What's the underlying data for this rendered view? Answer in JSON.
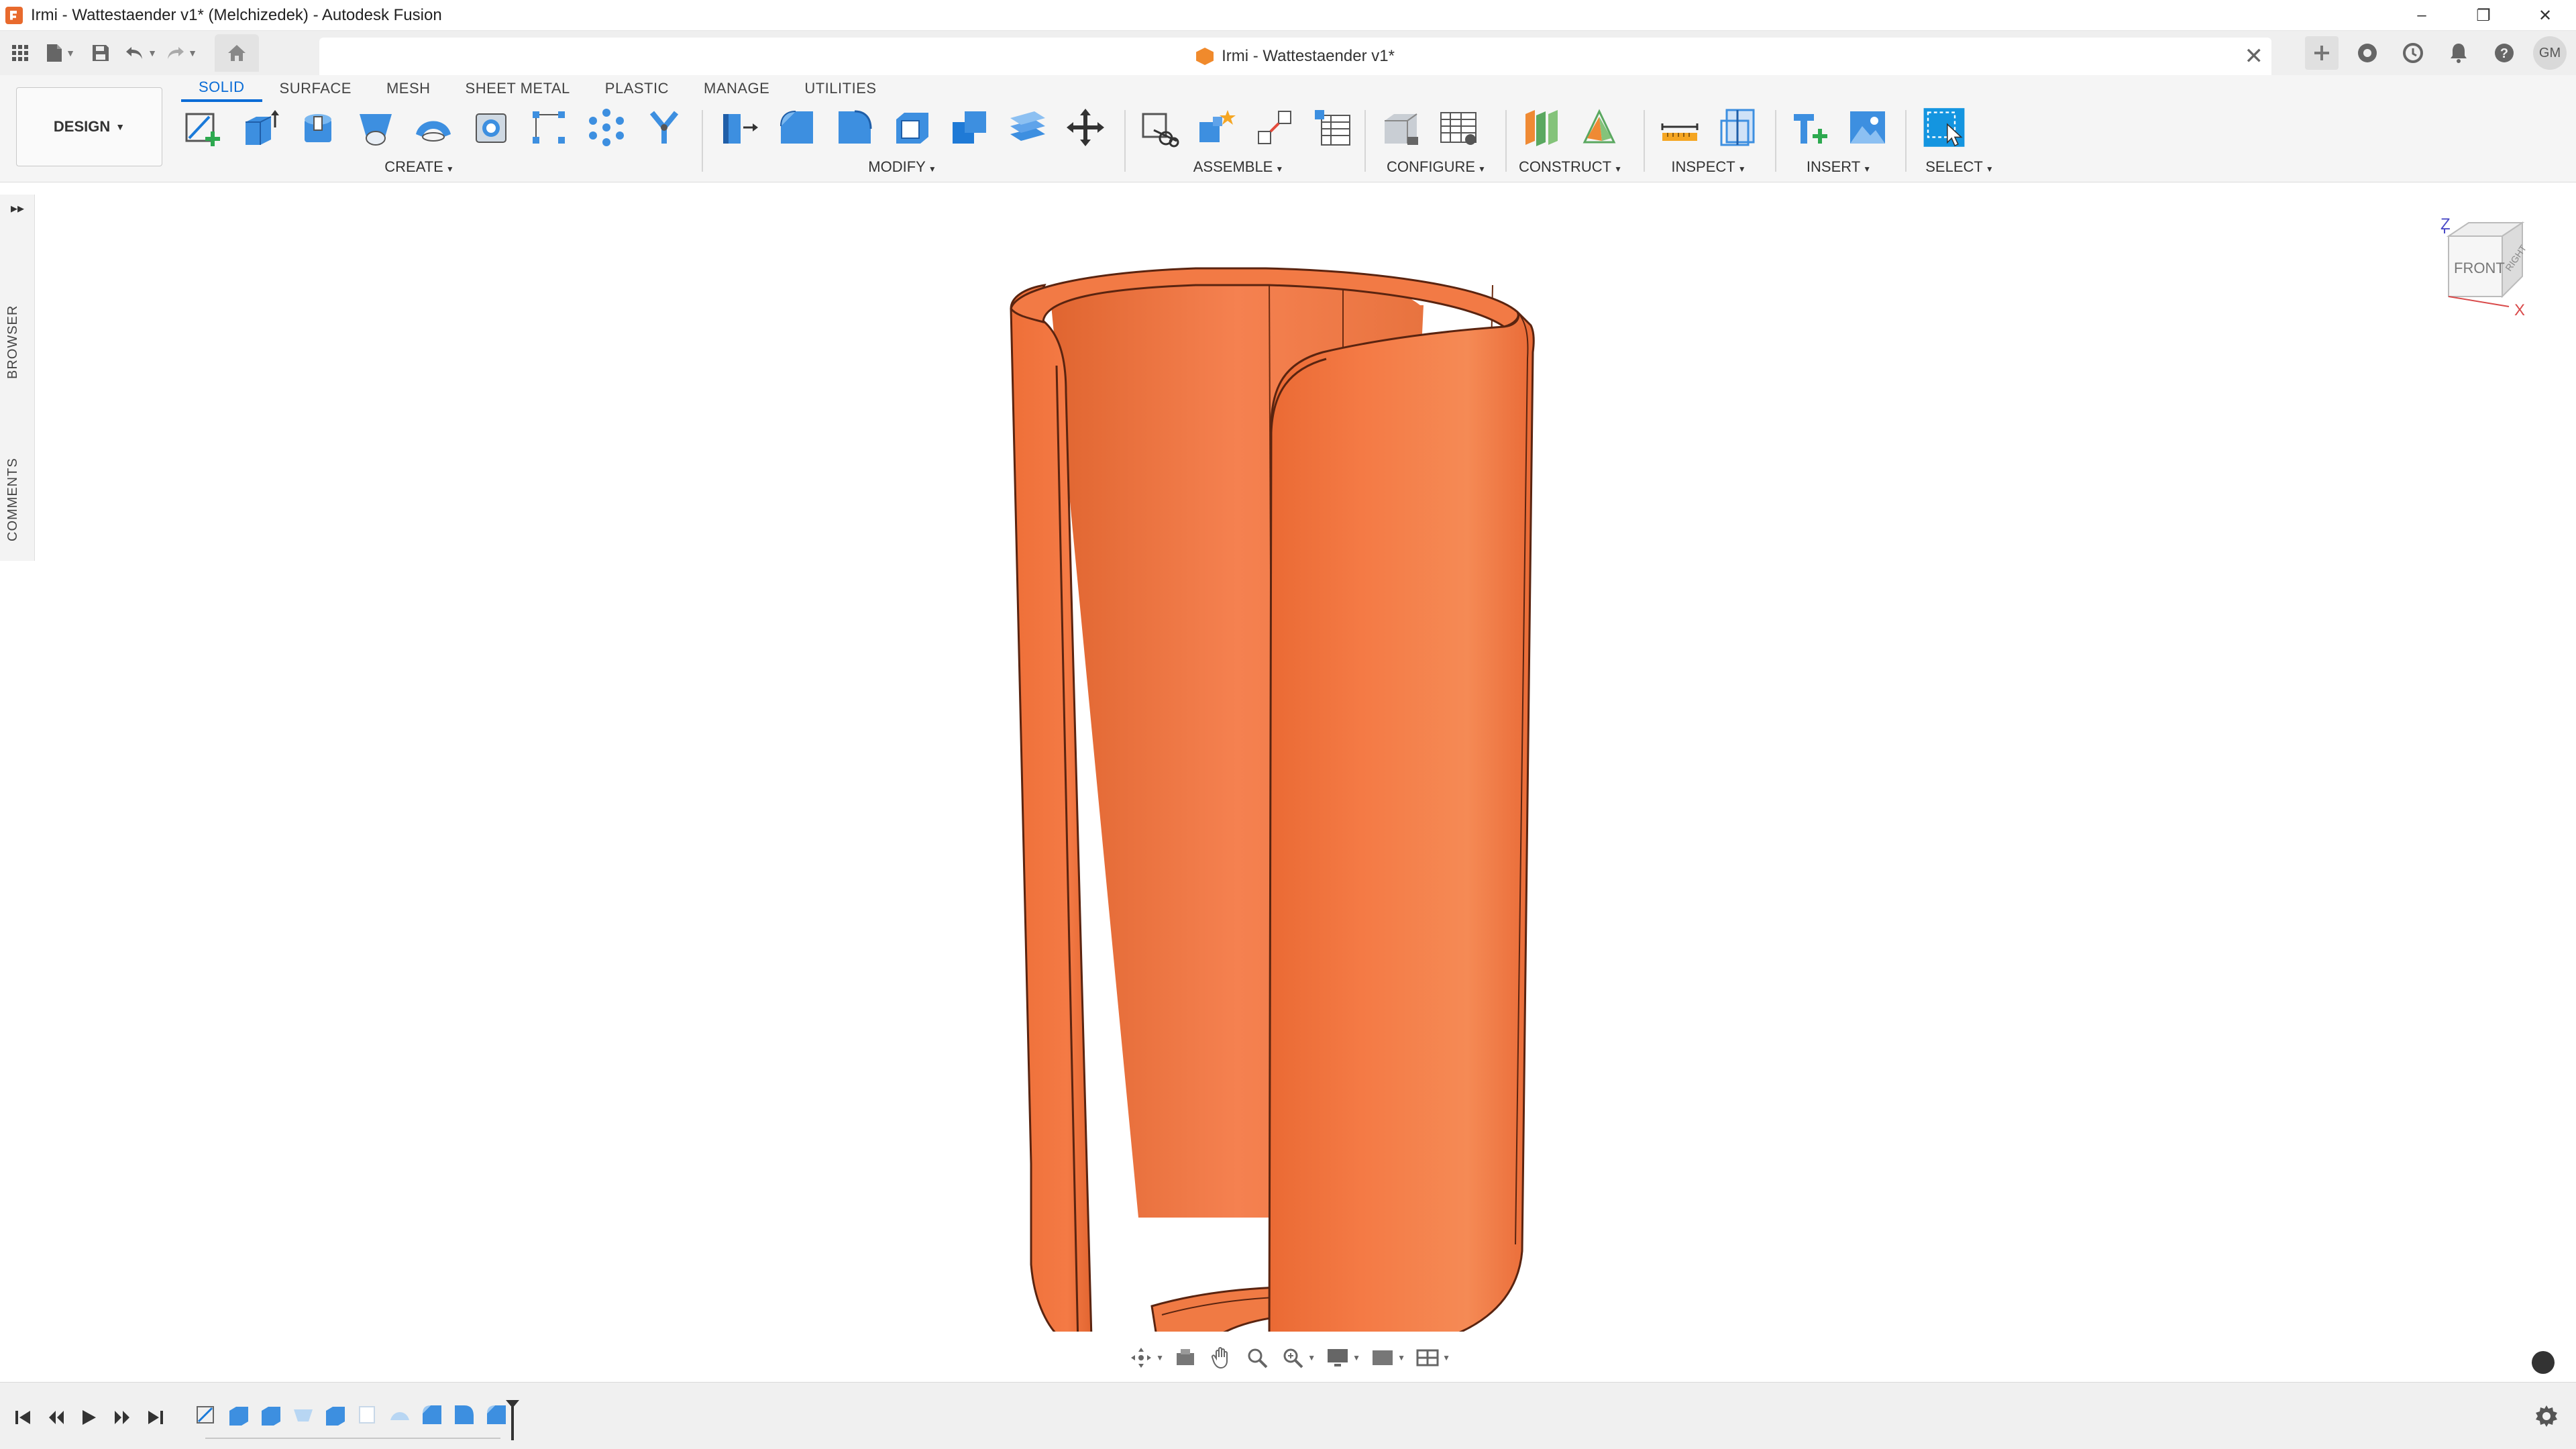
{
  "window": {
    "title": "Irmi - Wattestaender v1* (Melchizedek) - Autodesk Fusion",
    "controls": [
      "–",
      "❐",
      "✕"
    ]
  },
  "tabs": {
    "document_tab": "Irmi - Wattestaender v1*",
    "close_glyph": "✕",
    "avatar_initials": "GM"
  },
  "toolbar": {
    "workspace_button": "DESIGN",
    "workspace_tabs": [
      "SOLID",
      "SURFACE",
      "MESH",
      "SHEET METAL",
      "PLASTIC",
      "MANAGE",
      "UTILITIES"
    ],
    "active_tab": "SOLID",
    "groups": {
      "create": "CREATE",
      "modify": "MODIFY",
      "assemble": "ASSEMBLE",
      "configure": "CONFIGURE",
      "construct": "CONSTRUCT",
      "inspect": "INSPECT",
      "insert": "INSERT",
      "select": "SELECT"
    }
  },
  "left_panel": {
    "browser_label": "BROWSER",
    "comments_label": "COMMENTS"
  },
  "viewcube": {
    "front_label": "FRONT",
    "right_label": "RIGHT",
    "z_axis": "Z",
    "x_axis": "X"
  },
  "colors": {
    "accent": "#0a6cd6",
    "model_orange": "#f47a45",
    "model_dark": "#d95c2a",
    "select_blue": "#1495e0"
  }
}
